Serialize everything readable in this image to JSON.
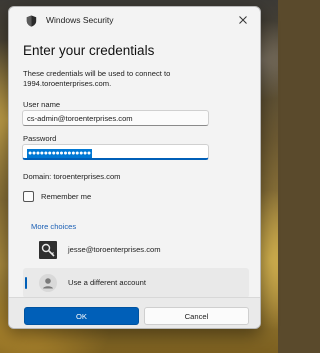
{
  "window": {
    "app_title": "Windows Security",
    "close_icon": "close-icon"
  },
  "dialog": {
    "heading": "Enter your credentials",
    "description": "These credentials will be used to connect to 1994.toroenterprises.com.",
    "user_name_label": "User name",
    "user_name_value": "cs-admin@toroenterprises.com",
    "password_label": "Password",
    "password_mask": "●●●●●●●●●●●●●●●●",
    "domain_text": "Domain: toroenterprises.com",
    "remember_label": "Remember me",
    "remember_checked": false,
    "more_choices_label": "More choices",
    "accounts": [
      {
        "label": "jesse@toroenterprises.com",
        "icon": "smartcard-icon",
        "selected": false
      },
      {
        "label": "Use a different account",
        "icon": "user-icon",
        "selected": true
      }
    ],
    "ok_label": "OK",
    "cancel_label": "Cancel"
  },
  "colors": {
    "accent": "#005fb8",
    "dialog_bg": "#f3f3f3",
    "link": "#1a5fb4"
  }
}
